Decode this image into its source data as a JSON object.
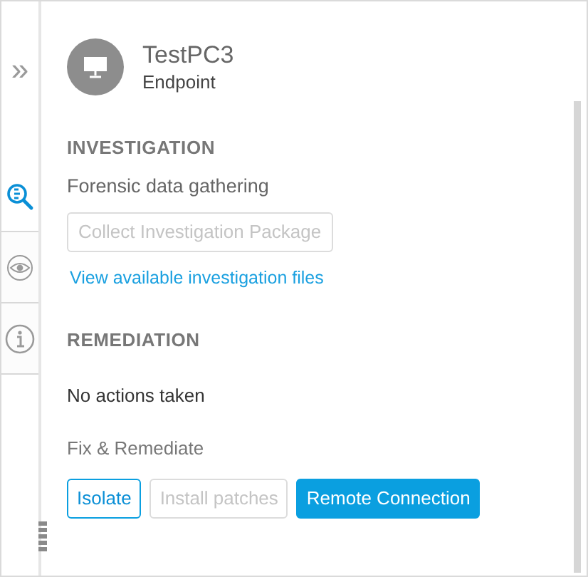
{
  "rail": {
    "expand": "»",
    "tabs": [
      {
        "kind": "investigate",
        "selected": true
      },
      {
        "kind": "view",
        "selected": false
      },
      {
        "kind": "info",
        "selected": false
      }
    ]
  },
  "device": {
    "name": "TestPC3",
    "type": "Endpoint"
  },
  "investigation": {
    "heading": "INVESTIGATION",
    "subheading": "Forensic data gathering",
    "button": {
      "label": "Collect Investigation Package",
      "disabled": true
    },
    "link": "View available investigation files"
  },
  "remediation": {
    "heading": "REMEDIATION",
    "status": "No actions taken",
    "subheading": "Fix & Remediate",
    "buttons": [
      {
        "label": "Isolate",
        "kind": "outline",
        "disabled": false
      },
      {
        "label": "Install patches",
        "kind": "outline",
        "disabled": true
      },
      {
        "label": "Remote Connection",
        "kind": "primary",
        "disabled": false
      }
    ]
  }
}
